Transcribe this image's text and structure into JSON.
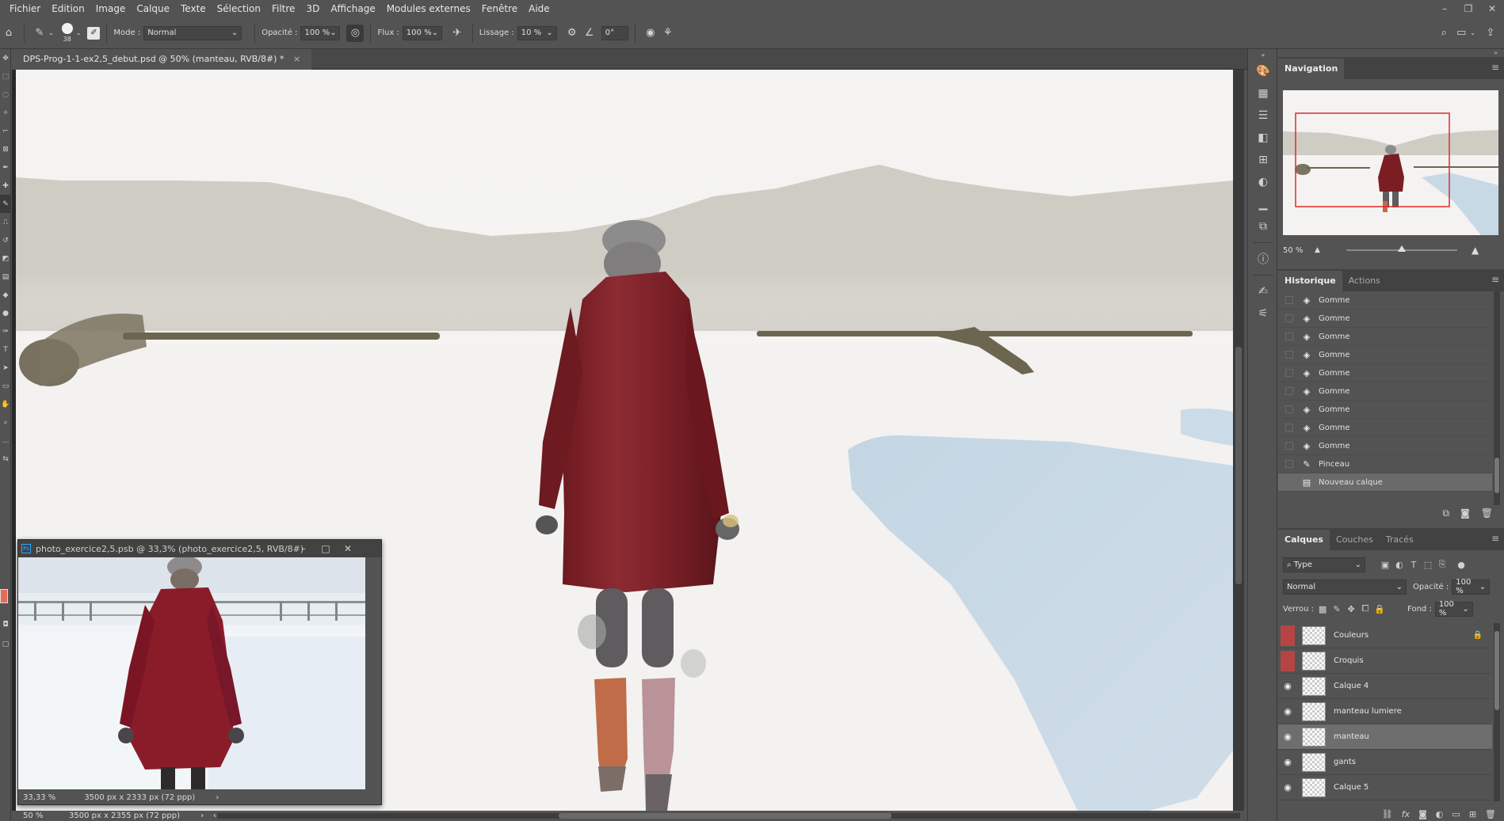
{
  "menubar": {
    "items": [
      "Fichier",
      "Edition",
      "Image",
      "Calque",
      "Texte",
      "Sélection",
      "Filtre",
      "3D",
      "Affichage",
      "Modules externes",
      "Fenêtre",
      "Aide"
    ]
  },
  "window_controls": [
    "–",
    "❐",
    "✕"
  ],
  "options_bar": {
    "brush_size": "38",
    "mode_label": "Mode :",
    "mode_value": "Normal",
    "opacity_label": "Opacité :",
    "opacity_value": "100 %",
    "flow_label": "Flux :",
    "flow_value": "100 %",
    "smoothing_label": "Lissage :",
    "smoothing_value": "10 %",
    "angle_value": "0°"
  },
  "document": {
    "tab_title": "DPS-Prog-1-1-ex2,5_debut.psd @ 50% (manteau, RVB/8#) *",
    "tab_close": "×",
    "status_zoom": "50 %",
    "status_size": "3500 px x 2355 px (72 ppp)",
    "status_arrow": "›",
    "scroll_left_arrow": "‹",
    "scroll_right_arrow": "›"
  },
  "photo_window": {
    "badge": "Ps",
    "title": "photo_exercice2,5.psb @ 33,3% (photo_exercice2,5, RVB/8#)",
    "zoom": "33,33 %",
    "size": "3500 px x 2333 px (72 ppp)",
    "arrow": "›"
  },
  "navigation": {
    "tab_label": "Navigation",
    "zoom_value": "50 %",
    "zoom_level": 0.5
  },
  "history": {
    "tabs": [
      "Historique",
      "Actions"
    ],
    "items": [
      {
        "label": "Gomme",
        "icon": "eraser-icon"
      },
      {
        "label": "Gomme",
        "icon": "eraser-icon"
      },
      {
        "label": "Gomme",
        "icon": "eraser-icon"
      },
      {
        "label": "Gomme",
        "icon": "eraser-icon"
      },
      {
        "label": "Gomme",
        "icon": "eraser-icon"
      },
      {
        "label": "Gomme",
        "icon": "eraser-icon"
      },
      {
        "label": "Gomme",
        "icon": "eraser-icon"
      },
      {
        "label": "Gomme",
        "icon": "eraser-icon"
      },
      {
        "label": "Gomme",
        "icon": "eraser-icon"
      },
      {
        "label": "Pinceau",
        "icon": "brush-icon"
      },
      {
        "label": "Nouveau calque",
        "icon": "new-layer-icon"
      }
    ]
  },
  "layers": {
    "tabs": [
      "Calques",
      "Couches",
      "Tracés"
    ],
    "filter_value": "Type",
    "blend_mode": "Normal",
    "opacity_label": "Opacité :",
    "opacity_value": "100 %",
    "lock_label": "Verrou :",
    "fill_label": "Fond :",
    "fill_value": "100 %",
    "items": [
      {
        "name": "Couleurs",
        "visible": false,
        "locked": true
      },
      {
        "name": "Croquis",
        "visible": false,
        "locked": false
      },
      {
        "name": "Calque 4",
        "visible": true,
        "locked": false
      },
      {
        "name": "manteau lumiere",
        "visible": true,
        "locked": false
      },
      {
        "name": "manteau",
        "visible": true,
        "locked": false,
        "selected": true
      },
      {
        "name": "gants",
        "visible": true,
        "locked": false
      },
      {
        "name": "Calque 5",
        "visible": true,
        "locked": false
      }
    ]
  },
  "colors": {
    "foreground": "#e66b57",
    "coat": "#7a1e24",
    "ice": "#c8d9e6",
    "hills": "#cfccc4"
  }
}
